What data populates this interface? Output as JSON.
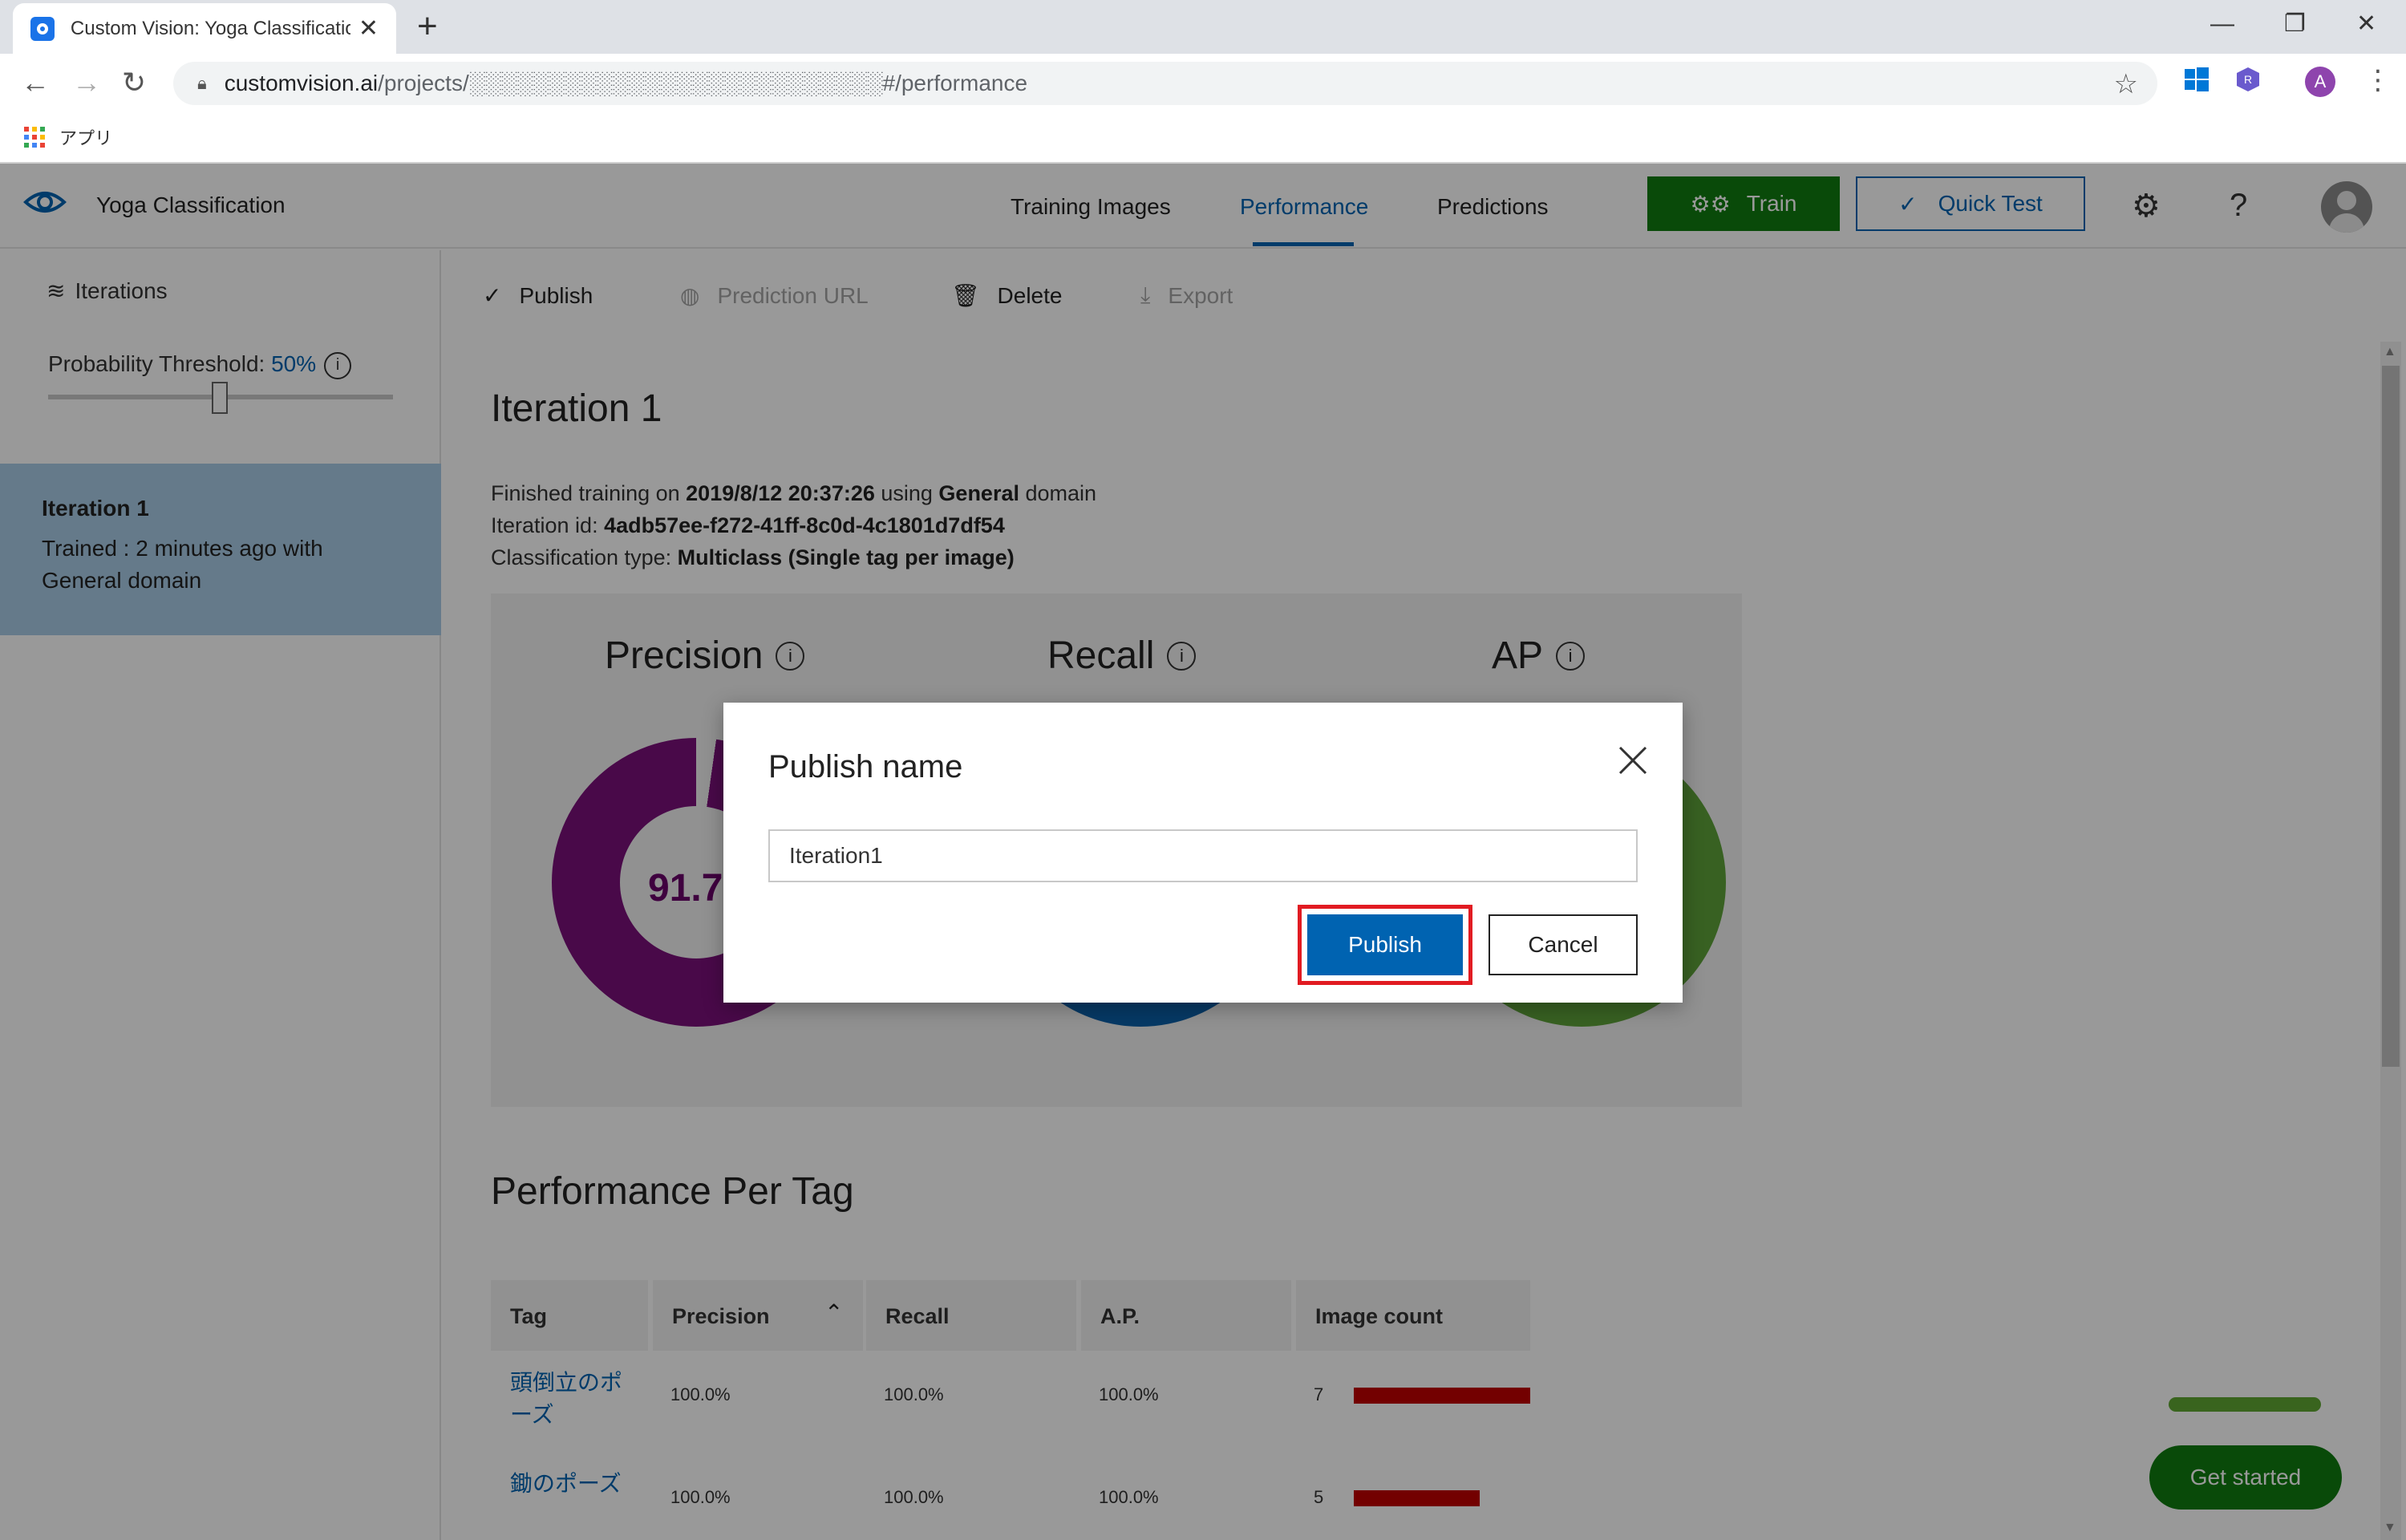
{
  "browser": {
    "tab_title": "Custom Vision: Yoga Classificatio",
    "url_host": "customvision.ai",
    "url_path": "/projects/░░░░░░░░░░░░░░░░░░░░░░░░░░#/performance",
    "bookmark_apps": "アプリ",
    "profile_initial": "A"
  },
  "header": {
    "project_name": "Yoga Classification",
    "tabs": [
      {
        "label": "Training Images",
        "active": false
      },
      {
        "label": "Performance",
        "active": true
      },
      {
        "label": "Predictions",
        "active": false
      }
    ],
    "train_label": "Train",
    "quick_test_label": "Quick Test"
  },
  "sidebar": {
    "iterations_label": "Iterations",
    "threshold_label": "Probability Threshold: ",
    "threshold_value": "50%",
    "threshold_fraction": 0.5,
    "iteration": {
      "title": "Iteration 1",
      "subtitle": "Trained : 2 minutes ago with General domain"
    }
  },
  "commands": {
    "publish": "Publish",
    "prediction_url": "Prediction URL",
    "delete": "Delete",
    "export": "Export"
  },
  "main": {
    "iteration_title": "Iteration 1",
    "meta_line1_prefix": "Finished training on ",
    "meta_line1_date": "2019/8/12 20:37:26",
    "meta_line1_mid": " using ",
    "meta_line1_domain": "General",
    "meta_line1_suffix": " domain",
    "meta_line2_prefix": "Iteration id: ",
    "meta_line2_value": "4adb57ee-f272-41ff-8c0d-4c1801d7df54",
    "meta_line3_prefix": "Classification type: ",
    "meta_line3_value": "Multiclass (Single tag per image)",
    "metrics": [
      {
        "label": "Precision",
        "value": "91.7",
        "color": "#7a0f7a"
      },
      {
        "label": "Recall",
        "value": "",
        "color": "#0a5fa8"
      },
      {
        "label": "AP",
        "value": "",
        "color": "#5ea23a"
      }
    ],
    "per_tag_title": "Performance Per Tag",
    "table": {
      "headers": [
        "Tag",
        "Precision",
        "Recall",
        "A.P.",
        "Image count"
      ],
      "rows": [
        {
          "tag": "頭倒立のポーズ",
          "precision": "100.0%",
          "recall": "100.0%",
          "ap": "100.0%",
          "count": "7",
          "count_value": 7
        },
        {
          "tag": "鋤のポーズ",
          "precision": "100.0%",
          "recall": "100.0%",
          "ap": "100.0%",
          "count": "5",
          "count_value": 5
        }
      ]
    },
    "get_started": "Get started"
  },
  "dialog": {
    "title": "Publish name",
    "input_value": "Iteration1",
    "publish_label": "Publish",
    "cancel_label": "Cancel"
  }
}
